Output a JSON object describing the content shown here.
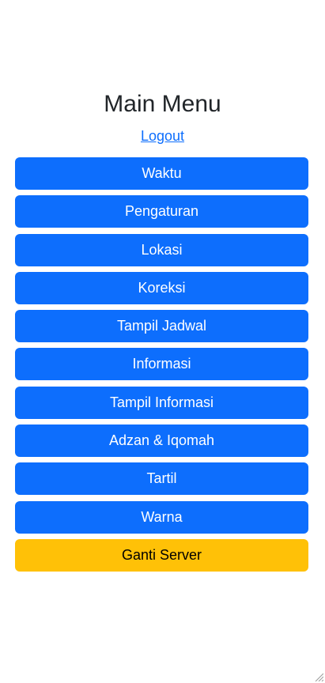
{
  "header": {
    "title": "Main Menu",
    "logout_label": "Logout"
  },
  "menu": {
    "items": [
      {
        "label": "Waktu"
      },
      {
        "label": "Pengaturan"
      },
      {
        "label": "Lokasi"
      },
      {
        "label": "Koreksi"
      },
      {
        "label": "Tampil Jadwal"
      },
      {
        "label": "Informasi"
      },
      {
        "label": "Tampil Informasi"
      },
      {
        "label": "Adzan & Iqomah"
      },
      {
        "label": "Tartil"
      },
      {
        "label": "Warna"
      }
    ],
    "server_label": "Ganti Server"
  },
  "colors": {
    "primary": "#0d6efd",
    "warning": "#ffc107",
    "title_text": "#212529"
  },
  "icons": {
    "resize": "resize-grip-icon"
  }
}
